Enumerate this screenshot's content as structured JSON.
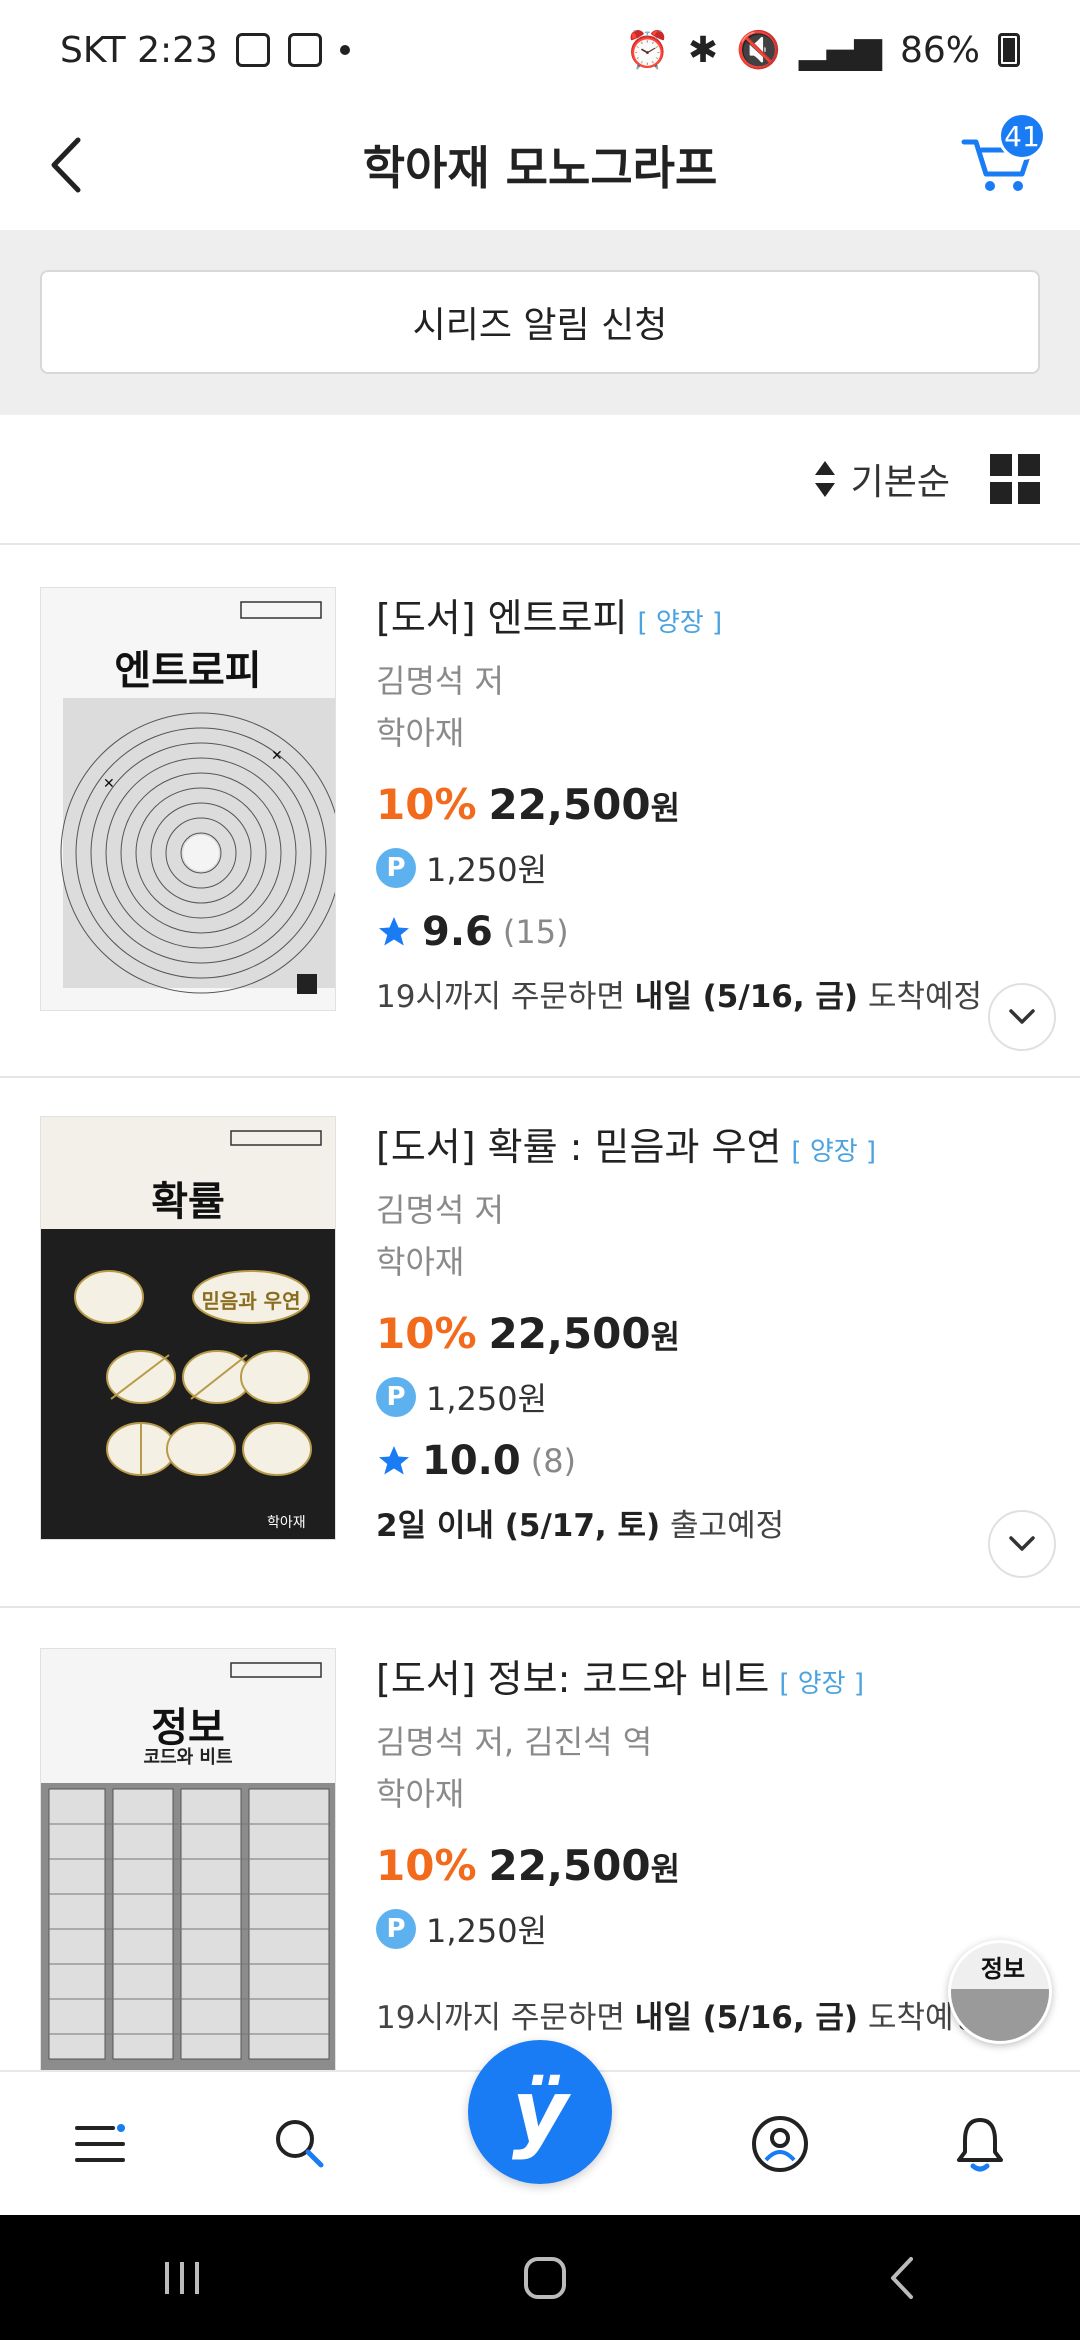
{
  "status_bar": {
    "carrier_time": "SKT 2:23",
    "battery": "86%"
  },
  "header": {
    "title": "학아재 모노그라프",
    "cart_count": "41"
  },
  "notify_button": "시리즈 알림 신청",
  "sort": {
    "label": "기본순"
  },
  "items": [
    {
      "cover_title": "엔트로피",
      "title": "[도서] 엔트로피",
      "tag": "[ 양장 ]",
      "author": "김명석 저",
      "publisher": "학아재",
      "discount": "10%",
      "price": "22,500",
      "price_unit": "원",
      "point": "1,250원",
      "rating": "9.6",
      "rating_count": "(15)",
      "delivery_prefix": "19시까지 주문하면 ",
      "delivery_bold": "내일 (5/16, 금)",
      "delivery_suffix": " 도착예정"
    },
    {
      "cover_title": "확률",
      "cover_subtitle": "믿음과 우연",
      "title": "[도서] 확률 : 믿음과 우연",
      "tag": "[ 양장 ]",
      "author": "김명석 저",
      "publisher": "학아재",
      "discount": "10%",
      "price": "22,500",
      "price_unit": "원",
      "point": "1,250원",
      "rating": "10.0",
      "rating_count": "(8)",
      "delivery_prefix": "",
      "delivery_bold": "2일 이내 (5/17, 토)",
      "delivery_suffix": " 출고예정"
    },
    {
      "cover_title": "정보",
      "cover_subtitle": "코드와 비트",
      "title": "[도서] 정보: 코드와 비트",
      "tag": "[ 양장 ]",
      "author": "김명석 저, 김진석 역",
      "publisher": "학아재",
      "discount": "10%",
      "price": "22,500",
      "price_unit": "원",
      "point": "1,250원",
      "delivery_prefix": "19시까지 주문하면 ",
      "delivery_bold": "내일 (5/16, 금)",
      "delivery_suffix": " 도착예정"
    }
  ],
  "bottom_nav": {
    "center_logo": "ÿ"
  },
  "icons": [
    "back-arrow-icon",
    "cart-icon",
    "sort-icon",
    "grid-view-icon",
    "point-icon",
    "star-icon",
    "chevron-down-icon",
    "menu-icon",
    "search-icon",
    "profile-icon",
    "bell-icon"
  ],
  "colors": {
    "accent": "#1a7cf5",
    "discount": "#f26b1d",
    "tag": "#4aa3df",
    "point": "#5eb1ef"
  }
}
